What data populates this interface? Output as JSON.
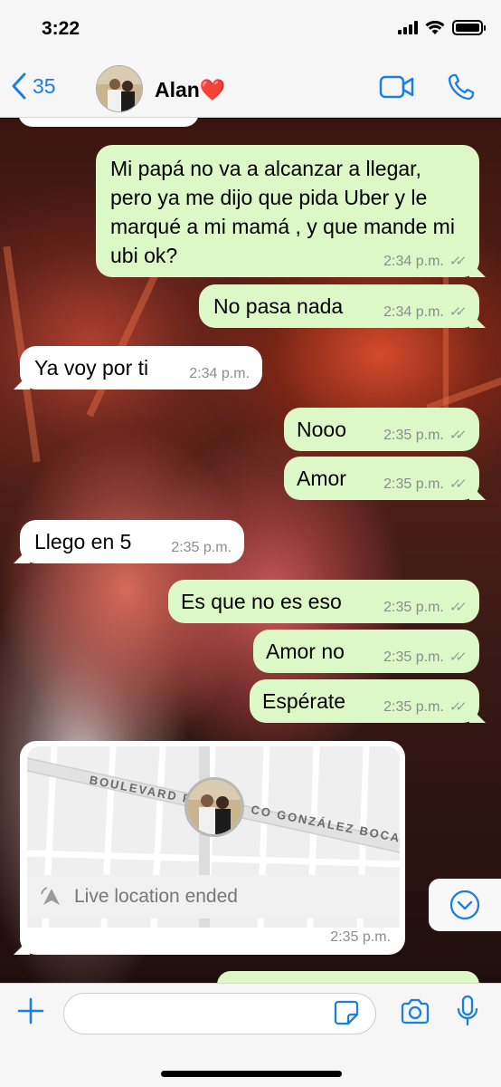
{
  "status_bar": {
    "time": "3:22"
  },
  "header": {
    "back_count": "35",
    "contact_name": "Alan❤️"
  },
  "messages": [
    {
      "text": "Mi papá no va a alcanzar a llegar, pero ya me dijo que pida Uber y le marqué a mi mamá , y que mande mi ubi ok?",
      "time": "2:34 p.m."
    },
    {
      "text": "No pasa nada",
      "time": "2:34 p.m."
    },
    {
      "text": "Ya voy por ti",
      "time": "2:34 p.m."
    },
    {
      "text": "Nooo",
      "time": "2:35 p.m."
    },
    {
      "text": "Amor",
      "time": "2:35 p.m."
    },
    {
      "text": "Llego en 5",
      "time": "2:35 p.m."
    },
    {
      "text": "Es que no es eso",
      "time": "2:35 p.m."
    },
    {
      "text": "Amor no",
      "time": "2:35 p.m."
    },
    {
      "text": "Espérate",
      "time": "2:35 p.m."
    }
  ],
  "location": {
    "street_1": "BOULEVARD F",
    "street_2": "CO GONZÁLEZ BOCANE",
    "status": "Live location ended",
    "time": "2:35 p.m."
  },
  "input": {
    "placeholder": ""
  },
  "icons": {
    "back": "chevron-left-icon",
    "video": "video-camera-icon",
    "call": "phone-icon",
    "plus": "plus-icon",
    "sticker": "sticker-icon",
    "camera": "camera-icon",
    "mic": "microphone-icon",
    "scroll": "chevron-down-circle-icon",
    "live": "live-location-icon"
  },
  "colors": {
    "accent": "#1a7fe0",
    "outgoing_bubble": "#dcf8c6",
    "incoming_bubble": "#ffffff",
    "timestamp": "#8c8c8c"
  }
}
